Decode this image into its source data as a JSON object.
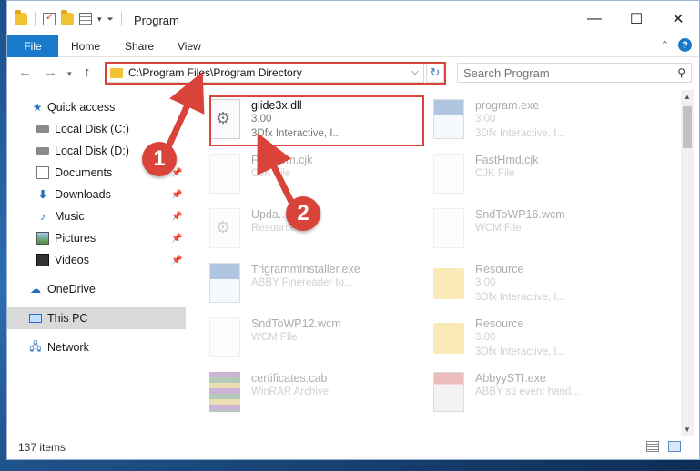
{
  "window": {
    "title": "Program",
    "controls": {
      "minimize": "—",
      "maximize": "☐",
      "close": "✕"
    }
  },
  "ribbon": {
    "tabs": [
      "File",
      "Home",
      "Share",
      "View"
    ],
    "file_color": "#1979ca"
  },
  "address": {
    "path": "C:\\Program Files\\Program Directory",
    "search_placeholder": "Search Program"
  },
  "nav": {
    "items": [
      {
        "label": "Quick access",
        "icon": "star-icon"
      },
      {
        "label": "Local Disk (C:)",
        "icon": "disk-icon"
      },
      {
        "label": "Local Disk (D:)",
        "icon": "disk-icon"
      },
      {
        "label": "Documents",
        "icon": "documents-icon",
        "pinned": true
      },
      {
        "label": "Downloads",
        "icon": "download-icon",
        "pinned": true
      },
      {
        "label": "Music",
        "icon": "music-icon",
        "pinned": true
      },
      {
        "label": "Pictures",
        "icon": "pictures-icon",
        "pinned": true
      },
      {
        "label": "Videos",
        "icon": "videos-icon",
        "pinned": true
      },
      {
        "label": "OneDrive",
        "icon": "cloud-icon"
      },
      {
        "label": "This PC",
        "icon": "computer-icon",
        "selected": true
      },
      {
        "label": "Network",
        "icon": "network-icon"
      }
    ]
  },
  "files": {
    "highlighted": {
      "name": "glide3x.dll",
      "line1": "3.00",
      "line2": "3Dfx Interactive, I..."
    },
    "others": [
      {
        "name": "program.exe",
        "line1": "3.00",
        "line2": "3Dfx Interactive, I...",
        "icon": "app-icon"
      },
      {
        "name": "Fd...com.cjk",
        "line1": "CJK File",
        "line2": "",
        "icon": "file-icon"
      },
      {
        "name": "FastHmd.cjk",
        "line1": "CJK File",
        "line2": "",
        "icon": "file-icon"
      },
      {
        "name": "Upda...365.dll",
        "line1": "Resource...",
        "line2": "",
        "icon": "dll-icon"
      },
      {
        "name": "SndToWP16.wcm",
        "line1": "WCM File",
        "line2": "",
        "icon": "file-icon"
      },
      {
        "name": "TrigrammInstaller.exe",
        "line1": "ABBY Finereader to...",
        "line2": "",
        "icon": "app-icon"
      },
      {
        "name": "Resource",
        "line1": "3.00",
        "line2": "3Dfx Interactive, I...",
        "icon": "folder-icon"
      },
      {
        "name": "SndToWP12.wcm",
        "line1": "WCM File",
        "line2": "",
        "icon": "file-icon"
      },
      {
        "name": "Resource",
        "line1": "3.00",
        "line2": "3Dfx Interactive, I...",
        "icon": "folder-icon"
      },
      {
        "name": "certificates.cab",
        "line1": "WinRAR Archive",
        "line2": "",
        "icon": "archive-icon"
      },
      {
        "name": "AbbyySTI.exe",
        "line1": "ABBY sti event hand...",
        "line2": "",
        "icon": "exe-icon"
      }
    ]
  },
  "status": {
    "item_count": "137 items"
  },
  "annotations": {
    "step1": "1",
    "step2": "2",
    "color": "#d9433a"
  }
}
